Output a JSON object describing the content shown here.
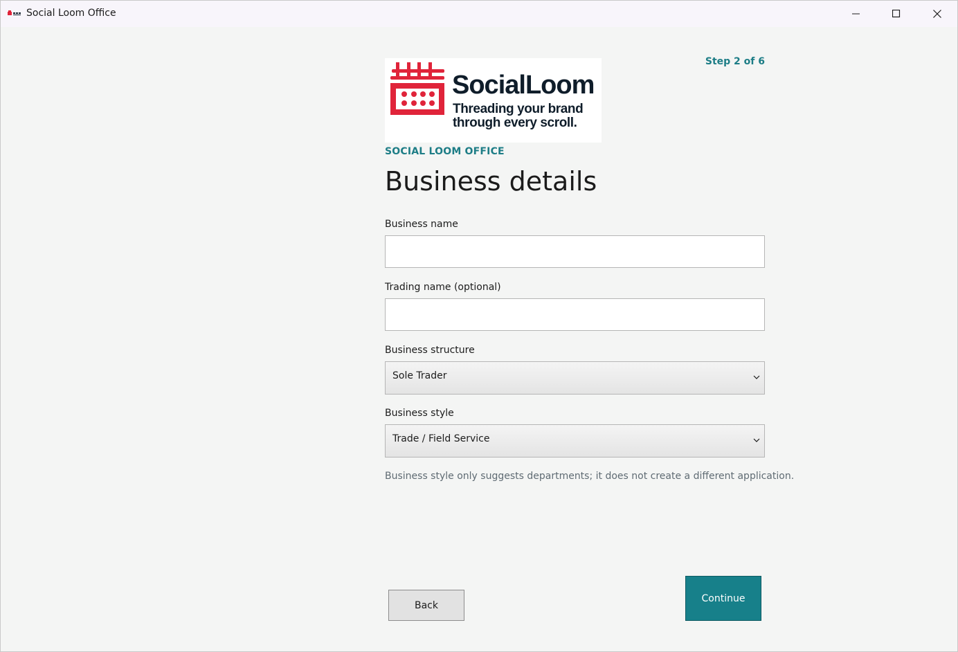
{
  "window": {
    "title": "Social Loom Office",
    "icon": "social-loom-app-icon",
    "controls": {
      "minimize_icon": "minimize-icon",
      "maximize_icon": "maximize-icon",
      "close_icon": "close-icon"
    }
  },
  "wizard": {
    "step": "Step 2 of 6"
  },
  "logo": {
    "name": "SocialLoom",
    "tagline": "Threading your brand through every scroll.",
    "mark_icon": "loom-icon",
    "brand_color": "#e0243a"
  },
  "header": {
    "eyebrow": "SOCIAL LOOM OFFICE",
    "title": "Business details"
  },
  "form": {
    "business_name": {
      "label": "Business name",
      "value": "",
      "placeholder": ""
    },
    "trading_name": {
      "label": "Trading name (optional)",
      "value": "",
      "placeholder": ""
    },
    "business_structure": {
      "label": "Business structure",
      "value": "Sole Trader"
    },
    "business_style": {
      "label": "Business style",
      "value": "Trade / Field Service"
    },
    "hint": "Business style only suggests departments; it does not create a different application."
  },
  "actions": {
    "back_label": "Back",
    "continue_label": "Continue"
  },
  "colors": {
    "accent": "#1d7d86",
    "primary_button": "#17808a"
  }
}
